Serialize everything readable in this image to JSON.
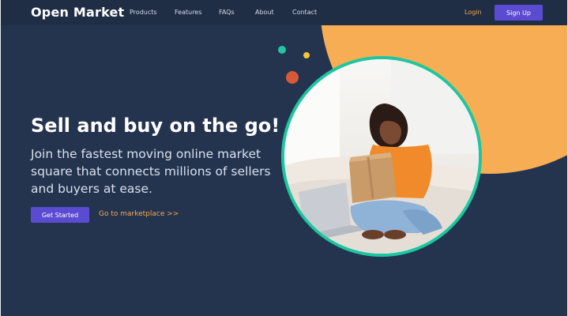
{
  "app": {
    "brand": "Open Market"
  },
  "nav": {
    "links": [
      "Products",
      "Features",
      "FAQs",
      "About",
      "Contact"
    ],
    "login": "Login",
    "signup": "Sign Up"
  },
  "hero": {
    "title": "Sell and buy on the go!",
    "subtitle": "Join the fastest moving online market square that connects millions of sellers and buyers at ease.",
    "primary_cta": "Get Started",
    "secondary_cta": "Go to marketplace >>",
    "image_alt": "woman-opening-package-on-couch"
  },
  "colors": {
    "background": "#24344f",
    "nav_background": "#1f2d45",
    "accent_purple": "#5a4bd0",
    "accent_orange": "#f7ad54",
    "accent_green": "#1cc69f",
    "accent_yellow": "#f5c533",
    "accent_red": "#d65a3a"
  }
}
